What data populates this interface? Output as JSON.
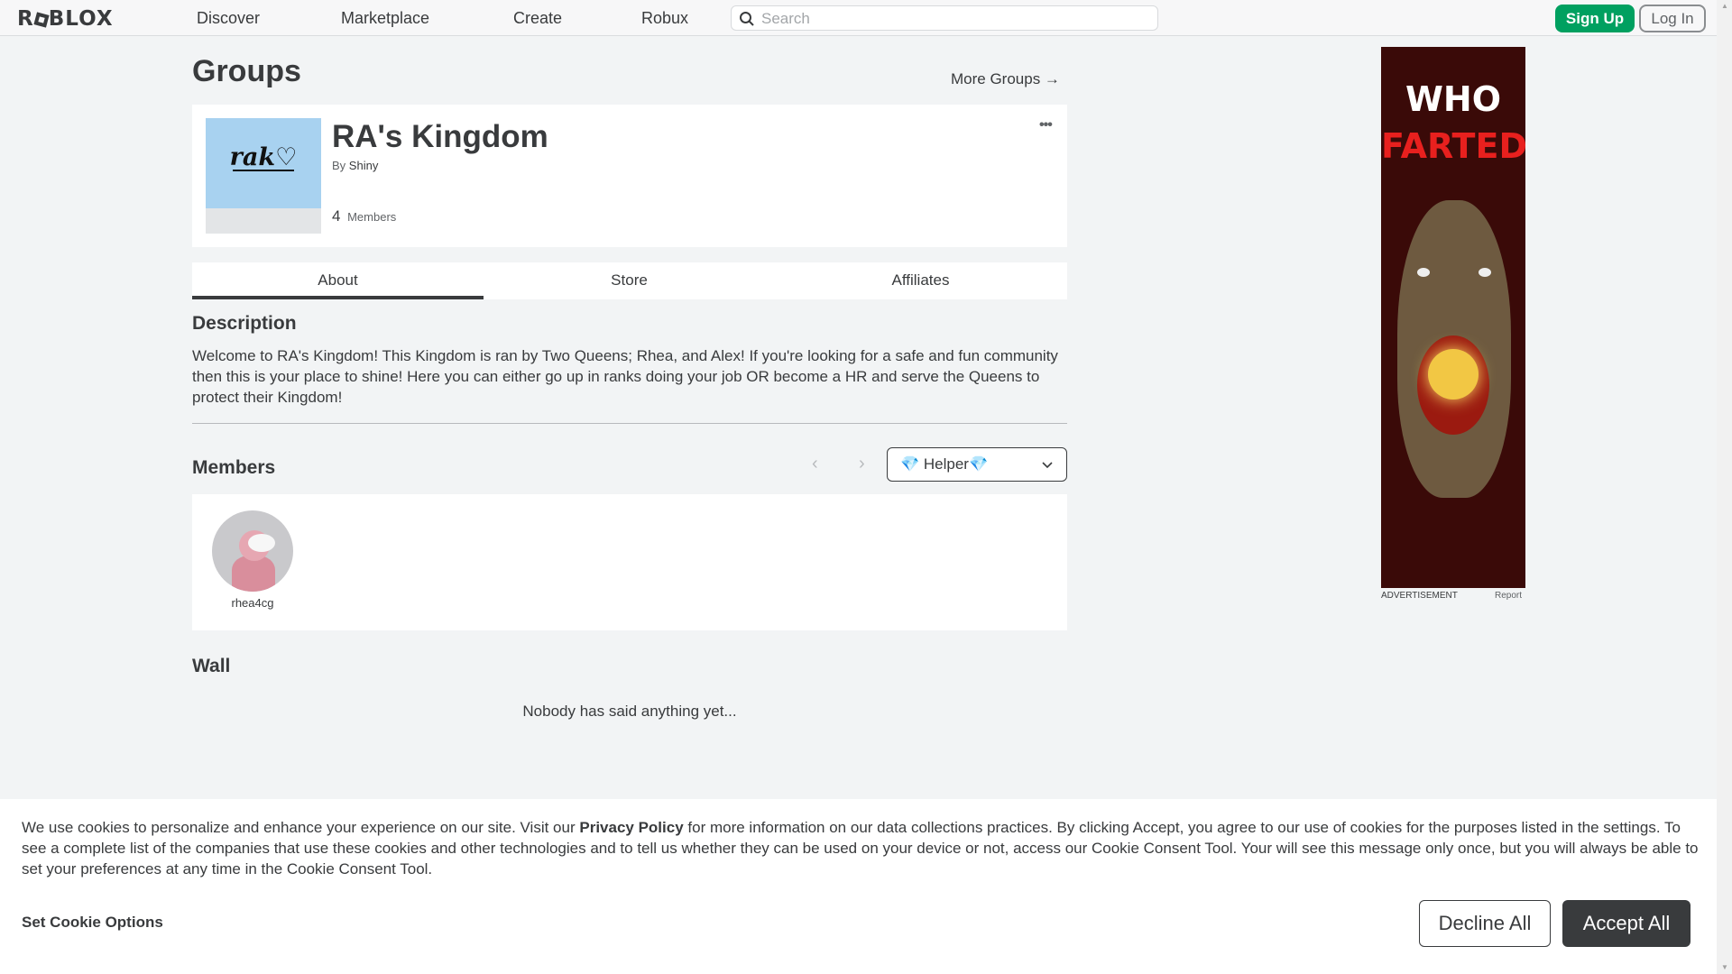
{
  "header": {
    "logo": "ROBLOX",
    "nav": [
      "Discover",
      "Marketplace",
      "Create",
      "Robux"
    ],
    "search_placeholder": "Search",
    "signup_label": "Sign Up",
    "login_label": "Log In"
  },
  "page": {
    "title": "Groups",
    "more_groups": "More Groups →"
  },
  "group": {
    "emblem_text": "rak♡",
    "name": "RA's Kingdom",
    "by_label": "By",
    "owner": "Shiny",
    "members_count": "4",
    "members_label": "Members",
    "more_menu": "•••"
  },
  "tabs": [
    "About",
    "Store",
    "Affiliates"
  ],
  "active_tab": "About",
  "description": {
    "heading": "Description",
    "text": "Welcome to RA's Kingdom! This Kingdom is ran by Two Queens; Rhea, and Alex! If you're looking for a safe and fun community then this is your place to shine! Here you can either go up in ranks doing your job OR become a HR and serve the Queens to protect their Kingdom!"
  },
  "members": {
    "heading": "Members",
    "prev": "‹",
    "next": "›",
    "role_selected": "💎 Helper💎",
    "list": [
      {
        "name": "rhea4cg"
      }
    ]
  },
  "wall": {
    "heading": "Wall",
    "empty_text": "Nobody has said anything yet..."
  },
  "ad": {
    "line1": "WHO",
    "line2": "FARTED",
    "label": "ADVERTISEMENT",
    "report": "Report"
  },
  "cookie": {
    "text_before": "We use cookies to personalize and enhance your experience on our site. Visit our ",
    "privacy_link": "Privacy Policy",
    "text_after": " for more information on our data collections practices. By clicking Accept, you agree to our use of cookies for the purposes listed in the settings. To see a complete list of the companies that use these cookies and other technologies and to tell us whether they can be used on your device or not, access our Cookie Consent Tool. Your will see this message only once, but you will always be able to set your preferences at any time in the Cookie Consent Tool.",
    "set_options": "Set Cookie Options",
    "decline": "Decline All",
    "accept": "Accept All"
  },
  "colors": {
    "signup_green": "#00a060",
    "text_dark": "#393b3d",
    "page_bg": "#f2f4f5"
  }
}
